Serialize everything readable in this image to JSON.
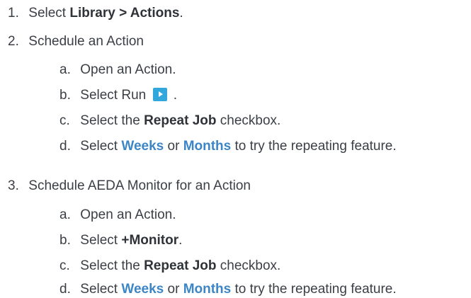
{
  "steps": [
    {
      "num": "1.",
      "pre": "Select ",
      "bold": "Library > Actions",
      "post": "."
    },
    {
      "num": "2.",
      "text": "Schedule an Action",
      "sub": [
        {
          "num": "a.",
          "text": "Open an Action."
        },
        {
          "num": "b.",
          "pre": "Select Run",
          "icon": "play-icon",
          "post": "."
        },
        {
          "num": "c.",
          "pre": "Select the ",
          "bold": "Repeat Job",
          "post": " checkbox."
        },
        {
          "num": "d.",
          "pre": "Select ",
          "link1": "Weeks",
          "mid": " or ",
          "link2": "Months",
          "post": " to try the repeating feature."
        }
      ]
    },
    {
      "num": "3.",
      "text": "Schedule AEDA Monitor for an Action",
      "sub": [
        {
          "num": "a.",
          "text": "Open an Action."
        },
        {
          "num": "b.",
          "pre": "Select ",
          "bold": "+Monitor",
          "post": "."
        },
        {
          "num": "c.",
          "pre": "Select the ",
          "bold": "Repeat Job",
          "post": " checkbox."
        },
        {
          "num": "d.",
          "pre": "Select ",
          "link1": "Weeks",
          "mid": " or ",
          "link2": "Months",
          "post": " to try the repeating feature."
        }
      ]
    }
  ],
  "colors": {
    "text": "#3b3f45",
    "link": "#3d86c6",
    "run_icon_bg": "#32a7dc"
  }
}
